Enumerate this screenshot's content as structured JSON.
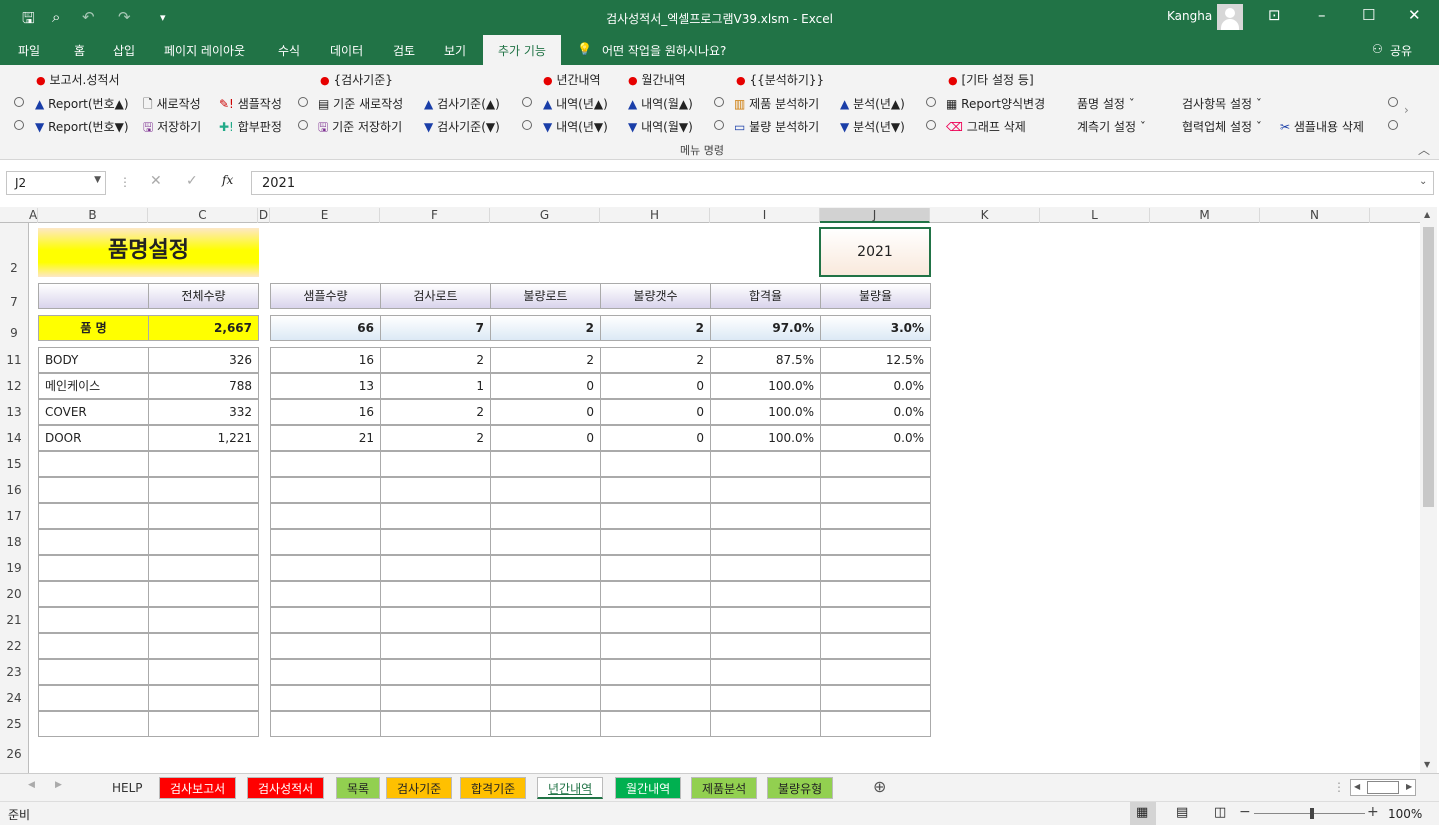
{
  "titlebar": {
    "title": "검사성적서_엑셀프로그램V39.xlsm  -  Excel",
    "user": "Kangha"
  },
  "ribbon_tabs": [
    "파일",
    "홈",
    "삽입",
    "페이지 레이아웃",
    "수식",
    "데이터",
    "검토",
    "보기",
    "추가 기능"
  ],
  "tell_me": "어떤 작업을 원하시나요?",
  "share": "공유",
  "ribbon": {
    "g1_title": "보고서.성적서",
    "report_up": "Report(번호▲)",
    "report_dn": "Report(번호▼)",
    "new_write": "새로작성",
    "save": "저장하기",
    "sample_write": "샘플작성",
    "pass_fail": "합부판정",
    "g2_title": "{검사기준}",
    "std_new": "기준 새로작성",
    "std_save": "기준 저장하기",
    "insp_std_up": "검사기준(▲)",
    "insp_std_dn": "검사기준(▼)",
    "g3_title": "년간내역",
    "year_up": "내역(년▲)",
    "year_dn": "내역(년▼)",
    "g4_title": "월간내역",
    "month_up": "내역(월▲)",
    "month_dn": "내역(월▼)",
    "g5_title": "{{분석하기}}",
    "prod_analysis": "제품 분석하기",
    "defect_analysis": "불량 분석하기",
    "ana_up": "분석(년▲)",
    "ana_dn": "분석(년▼)",
    "g6_title": "[기타 설정 등]",
    "report_form": "Report양식변경",
    "graph_del": "그래프 삭제",
    "item_set": "품명 설정 ˇ",
    "gauge_set": "계측기 설정 ˇ",
    "insp_item_set": "검사항목 설정 ˇ",
    "vendor_set": "협력업체 설정 ˇ",
    "sample_del": "샘플내용 삭제",
    "group_label": "메뉴 명령"
  },
  "formula_bar": {
    "name_box": "J2",
    "formula": "2021"
  },
  "columns": [
    "A",
    "B",
    "C",
    "D",
    "E",
    "F",
    "G",
    "H",
    "I",
    "J",
    "K",
    "L",
    "M",
    "N"
  ],
  "rows": [
    "2",
    "7",
    "9",
    "11",
    "12",
    "13",
    "14",
    "15",
    "16",
    "17",
    "18",
    "19",
    "20",
    "21",
    "22",
    "23",
    "24",
    "25",
    "26"
  ],
  "sheet": {
    "title": "품명설정",
    "year": "2021",
    "headers_left": [
      "전체수량"
    ],
    "headers_right": [
      "샘플수량",
      "검사로트",
      "불량로트",
      "불량갯수",
      "합격율",
      "불량율"
    ],
    "summary_label": "품  명",
    "summary_total": "2,667",
    "summary_values": [
      "66",
      "7",
      "2",
      "2",
      "97.0%",
      "3.0%"
    ],
    "items": [
      {
        "name": "BODY",
        "total": "326",
        "vals": [
          "16",
          "2",
          "2",
          "2",
          "87.5%",
          "12.5%"
        ]
      },
      {
        "name": "메인케이스",
        "total": "788",
        "vals": [
          "13",
          "1",
          "0",
          "0",
          "100.0%",
          "0.0%"
        ]
      },
      {
        "name": "COVER",
        "total": "332",
        "vals": [
          "16",
          "2",
          "0",
          "0",
          "100.0%",
          "0.0%"
        ]
      },
      {
        "name": "DOOR",
        "total": "1,221",
        "vals": [
          "21",
          "2",
          "0",
          "0",
          "100.0%",
          "0.0%"
        ]
      }
    ]
  },
  "sheet_tabs": [
    {
      "label": "HELP",
      "color": "#f3f3f3",
      "text": "#333"
    },
    {
      "label": "검사보고서",
      "color": "#ff0000",
      "text": "#fff"
    },
    {
      "label": "검사성적서",
      "color": "#ff0000",
      "text": "#fff"
    },
    {
      "label": "목록",
      "color": "#92d050",
      "text": "#222"
    },
    {
      "label": "검사기준",
      "color": "#ffc000",
      "text": "#222"
    },
    {
      "label": "합격기준",
      "color": "#ffc000",
      "text": "#222"
    },
    {
      "label": "년간내역",
      "color": "#ffffff",
      "text": "#217346"
    },
    {
      "label": "월간내역",
      "color": "#00b050",
      "text": "#fff"
    },
    {
      "label": "제품분석",
      "color": "#92d050",
      "text": "#222"
    },
    {
      "label": "불량유형",
      "color": "#92d050",
      "text": "#222"
    }
  ],
  "status": {
    "ready": "준비",
    "zoom": "100%"
  }
}
